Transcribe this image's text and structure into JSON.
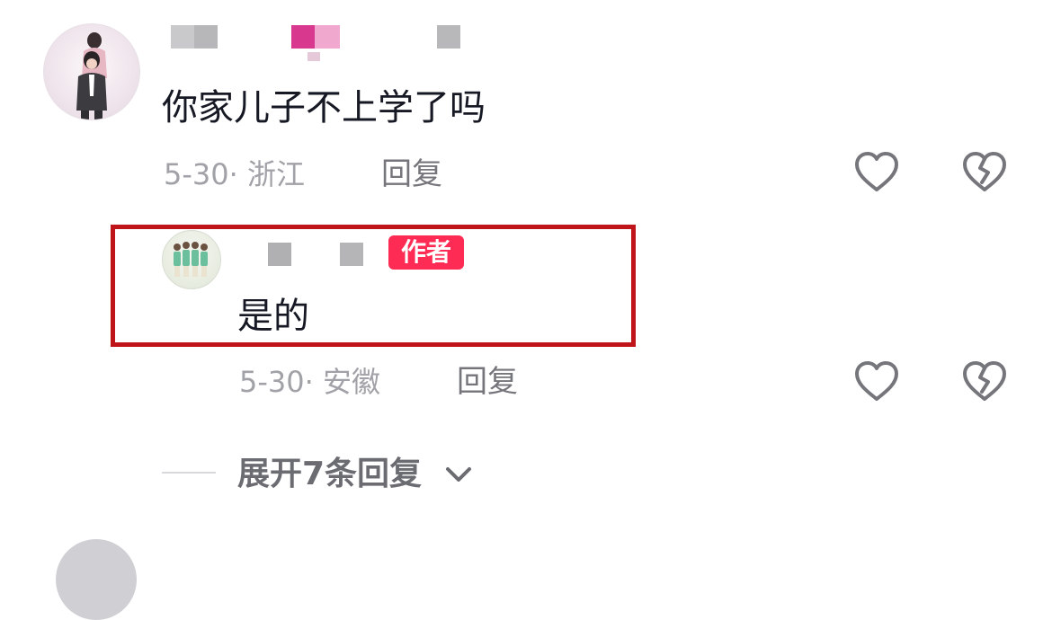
{
  "comments": [
    {
      "text": "你家儿子不上学了吗",
      "date": "5-30",
      "separator": "·",
      "location": "浙江",
      "reply_label": "回复",
      "like_icon": "heart-outline-icon",
      "dislike_icon": "broken-heart-icon"
    }
  ],
  "reply": {
    "badge": "作者",
    "text": "是的",
    "date": "5-30",
    "separator": "·",
    "location": "安徽",
    "reply_label": "回复",
    "like_icon": "heart-outline-icon",
    "dislike_icon": "broken-heart-icon"
  },
  "expand": {
    "label": "展开7条回复",
    "icon": "chevron-down-icon"
  },
  "colors": {
    "badge": "#fe2c55",
    "highlight_border": "#c0141b",
    "text_primary": "#161823",
    "text_meta": "#a1a2a7",
    "icon": "#75767b"
  }
}
